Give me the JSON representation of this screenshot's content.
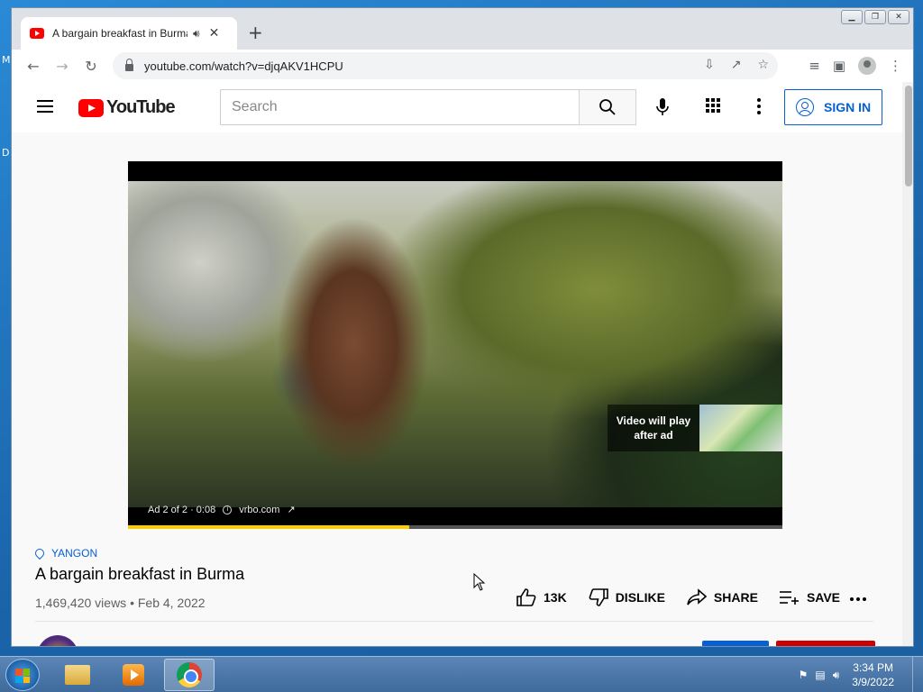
{
  "desktop": {
    "glyph_top": "M",
    "glyph_mid": "D"
  },
  "browser": {
    "tab": {
      "title": "A bargain breakfast in Burma",
      "audio_icon": "speaker-icon",
      "close_icon": "close-icon"
    },
    "new_tab_glyph": "+",
    "window_controls": {
      "minimize": "▁",
      "restore": "❐",
      "close": "✕"
    },
    "url": "youtube.com/watch?v=djqAKV1HCPU",
    "nav": {
      "back": "←",
      "forward": "→",
      "reload": "↻"
    },
    "omnibox_icons": [
      "install-icon",
      "share-icon",
      "star-icon"
    ],
    "toolbar_icons": [
      "media-icon",
      "sidepanel-icon",
      "profile-icon",
      "menu-icon"
    ]
  },
  "youtube": {
    "logo_text": "YouTube",
    "search_placeholder": "Search",
    "sign_in_label": "SIGN IN",
    "player": {
      "next_text_line1": "Video will play",
      "next_text_line2": "after ad",
      "ad_counter": "Ad 2 of 2 · 0:08",
      "ad_domain": "vrbo.com",
      "progress_fraction": 0.43
    },
    "video": {
      "location": "YANGON",
      "title": "A bargain breakfast in Burma",
      "views_date": "1,469,420 views • Feb 4, 2022"
    },
    "actions": {
      "like_count": "13K",
      "dislike_label": "DISLIKE",
      "share_label": "SHARE",
      "save_label": "SAVE"
    },
    "colors": {
      "brand_red": "#ff0000",
      "link_blue": "#065fd4",
      "ad_progress": "#ffcc00"
    }
  },
  "taskbar": {
    "clock_time": "3:34 PM",
    "clock_date": "3/9/2022",
    "apps": [
      "explorer-icon",
      "media-player-icon",
      "chrome-icon"
    ]
  }
}
